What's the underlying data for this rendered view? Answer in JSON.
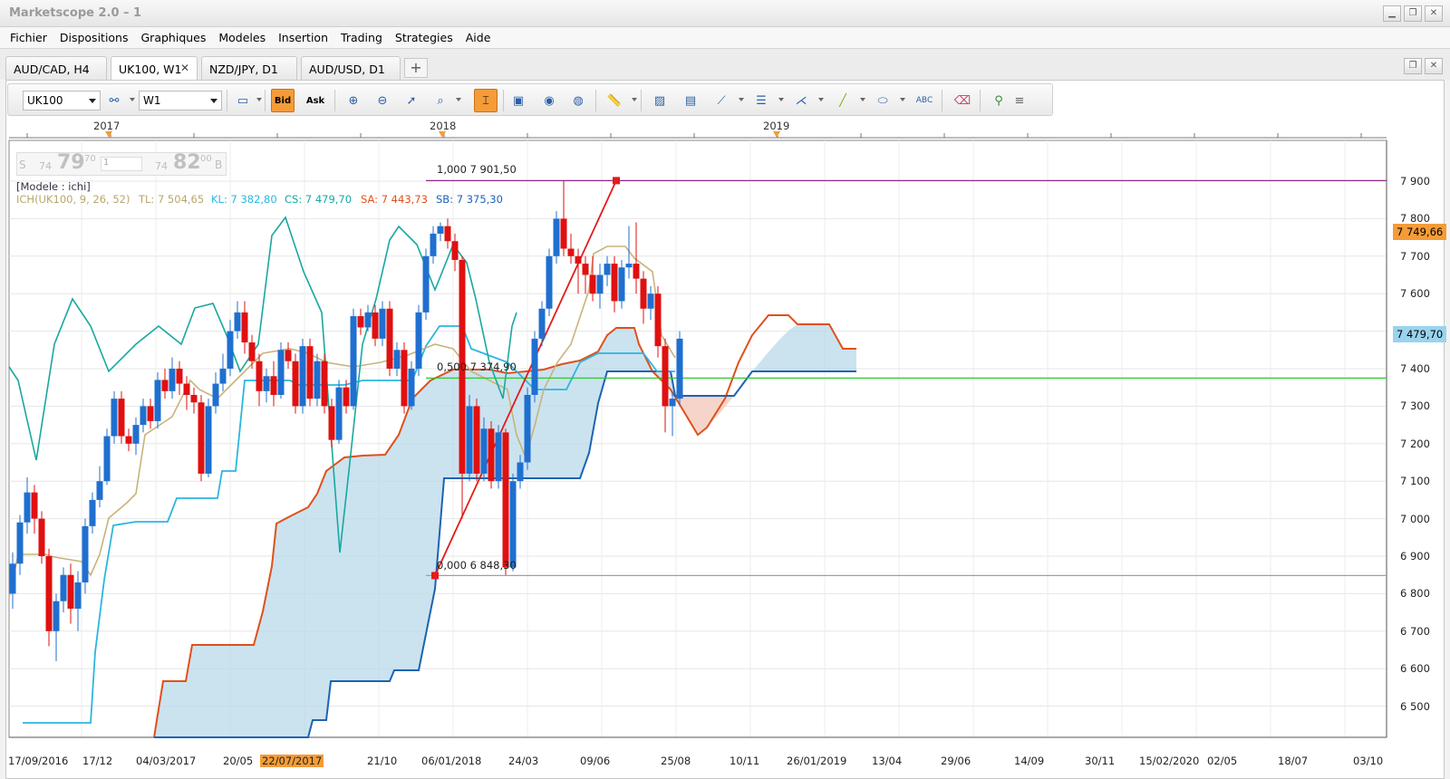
{
  "window": {
    "title": "Marketscope 2.0 – 1"
  },
  "menu": [
    "Fichier",
    "Dispositions",
    "Graphiques",
    "Modeles",
    "Insertion",
    "Trading",
    "Strategies",
    "Aide"
  ],
  "tabs": [
    {
      "label": "AUD/CAD, H4"
    },
    {
      "label": "UK100, W1",
      "active": true,
      "close": "✕"
    },
    {
      "label": "NZD/JPY, D1"
    },
    {
      "label": "AUD/USD, D1"
    }
  ],
  "toolbar": {
    "instrument": "UK100",
    "timeframe": "W1",
    "bid_label": "Bid",
    "ask_label": "Ask"
  },
  "quote": {
    "side_left": "S",
    "bid_prefix": "74",
    "bid_big": "79",
    "bid_sup": "70",
    "amount": "1",
    "ask_prefix": "74",
    "ask_big": "82",
    "ask_sup": "00",
    "side_right": "B"
  },
  "indicator": {
    "model": "[Modele : ichi]",
    "name": "ICH(UK100, 9, 26, 52)",
    "tl": "TL: 7 504,65",
    "kl": "KL: 7 382,80",
    "cs": "CS: 7 479,70",
    "sa": "SA: 7 443,73",
    "sb": "SB: 7 375,30"
  },
  "fibonacci": {
    "top": "1,000 7 901,50",
    "mid": "0,500 7 374,90",
    "bottom": "0,000 6 848,30"
  },
  "chart_data": {
    "type": "candlestick",
    "instrument": "UK100",
    "timeframe": "W1",
    "years": [
      "2017",
      "2018",
      "2019"
    ],
    "price_ticks": [
      "7 900",
      "7 800",
      "7 700",
      "7 600",
      "7 500",
      "7 400",
      "7 300",
      "7 200",
      "7 100",
      "7 000",
      "6 900",
      "6 800",
      "6 700",
      "6 600",
      "6 500"
    ],
    "price_range": [
      6420,
      7960
    ],
    "current_price_tag": "7 749,66",
    "cs_price_tag": "7 479,70",
    "date_ticks": [
      "17/09/2016",
      "17/12",
      "04/03/2017",
      "20/05",
      "22/07/2017",
      "21/10",
      "06/01/2018",
      "24/03",
      "09/06",
      "25/08",
      "10/11",
      "26/01/2019",
      "13/04",
      "29/06",
      "14/09",
      "30/11",
      "15/02/2020",
      "02/05",
      "18/07",
      "03/10"
    ],
    "highlighted_date": "22/07/2017",
    "horizontal_levels": {
      "fib_top": 7901.5,
      "fib_mid": 7374.9,
      "fib_bottom": 6848.3
    },
    "colors": {
      "up": "#1f6fd0",
      "down": "#e01010",
      "tenkan": "#c8b37a",
      "kijun": "#2bb6e0",
      "chikou": "#17a8a0",
      "span_a": "#e0501a",
      "span_b": "#1c63b4",
      "cloud_up": "#b9d9ea",
      "cloud_down": "#f6cfc3",
      "fib_line": "#e31b1b",
      "fib_top": "#8a2d8a",
      "fib_mid": "#2ec92e",
      "fib_bottom": "#a0a0a0"
    }
  }
}
